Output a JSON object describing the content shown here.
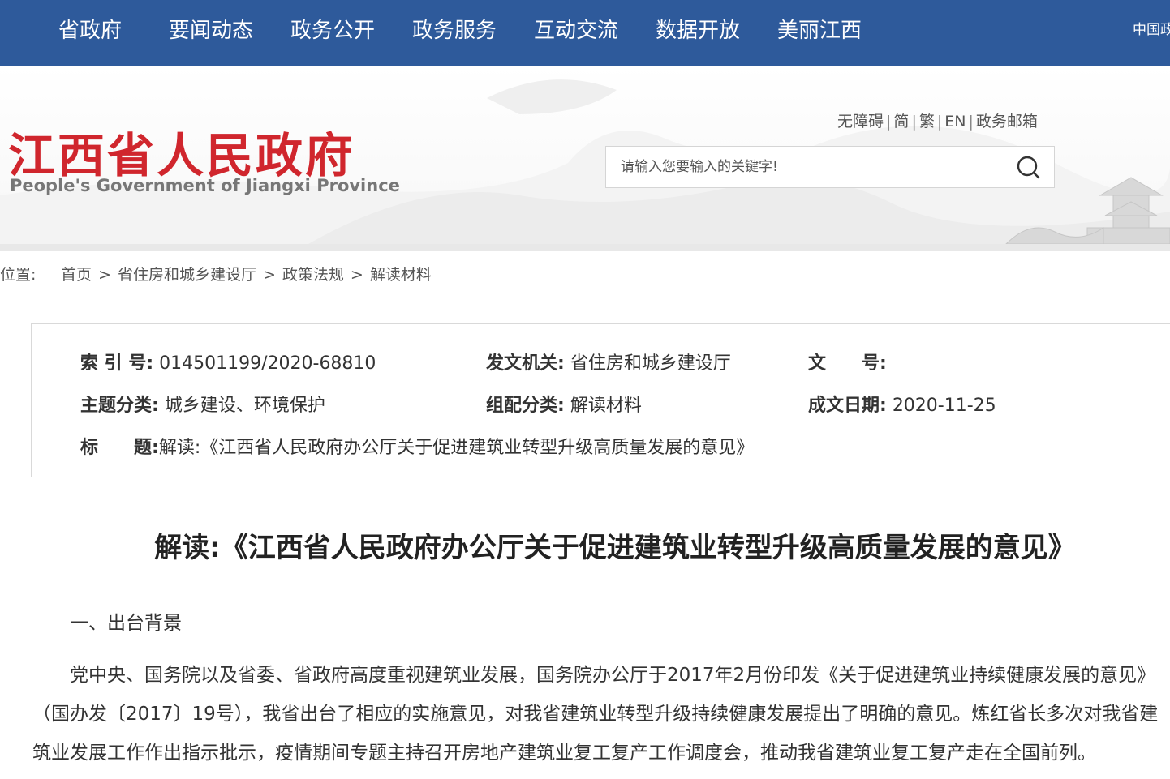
{
  "nav": {
    "items": [
      "省政府",
      "要闻动态",
      "政务公开",
      "政务服务",
      "互动交流",
      "数据开放",
      "美丽江西"
    ],
    "right_link": "中国政"
  },
  "header": {
    "logo_cn": "江西省人民政府",
    "logo_en": "People's Government of Jiangxi Province",
    "links": [
      "无障碍",
      "简",
      "繁",
      "EN",
      "政务邮箱"
    ],
    "search_placeholder": "请输入您要输入的关键字!",
    "search_icon": "search-icon"
  },
  "breadcrumb": {
    "label": "位置:",
    "items": [
      "首页",
      "省住房和城乡建设厅",
      "政策法规",
      "解读材料"
    ],
    "separator": ">"
  },
  "info": {
    "index_label": "索 引 号:",
    "index_value": "014501199/2020-68810",
    "issuer_label": "发文机关:",
    "issuer_value": "省住房和城乡建设厅",
    "docno_label": "文　　号:",
    "docno_value": "",
    "topic_label": "主题分类:",
    "topic_value": "城乡建设、环境保护",
    "group_label": "组配分类:",
    "group_value": "解读材料",
    "date_label": "成文日期:",
    "date_value": "2020-11-25",
    "title_label": "标　　题:",
    "title_value": "解读:《江西省人民政府办公厅关于促进建筑业转型升级高质量发展的意见》"
  },
  "article": {
    "title": "解读:《江西省人民政府办公厅关于促进建筑业转型升级高质量发展的意见》",
    "section1": "一、出台背景",
    "para1_lines": [
      "党中央、国务院以及省委、省政府高度重视建筑业发展，国务院办公厅于2017年2月份印发《关于促进建筑业持续健康发展的意见》",
      "（国办发〔2017〕19号），我省出台了相应的实施意见，对我省建筑业转型升级持续健康发展提出了明确的意见。炼红省长多次对我省建",
      "筑业发展工作作出指示批示，疫情期间专题主持召开房地产建筑业复工复产工作调度会，推动我省建筑业复工复产走在全国前列。"
    ]
  },
  "colors": {
    "nav_bg": "#2e5a9b",
    "logo_red": "#d0262d"
  }
}
